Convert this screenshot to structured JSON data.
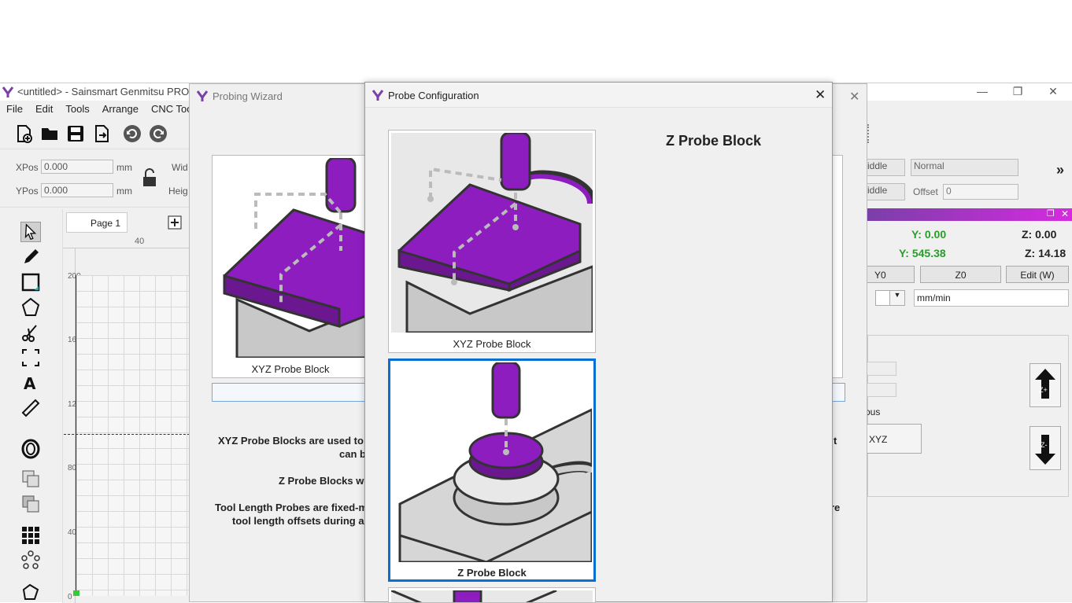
{
  "app": {
    "title": "<untitled> - Sainsmart Genmitsu PROVer",
    "menu": [
      "File",
      "Edit",
      "Tools",
      "Arrange",
      "CNC Tools"
    ],
    "xpos_label": "XPos",
    "ypos_label": "YPos",
    "xpos_value": "0.000",
    "ypos_value": "0.000",
    "unit": "mm",
    "width_label": "Wid",
    "height_label": "Heig",
    "page_tab": "Page 1",
    "ruler_top": [
      "40"
    ],
    "ruler_left": [
      "200",
      "160",
      "120",
      "80",
      "40",
      "0"
    ]
  },
  "right_panel": {
    "mode_select_1": "iddle",
    "mode_select_2": "iddle",
    "normal_select": "Normal",
    "offset_label": "Offset",
    "offset_value": "0",
    "y_pos": "Y: 0.00",
    "z_pos": "Z: 0.00",
    "y_machine": "Y: 545.38",
    "z_machine": "Z: 14.18",
    "btn_y0": "Y0",
    "btn_z0": "Z0",
    "btn_edit": "Edit (W)",
    "feed_unit": "mm/min",
    "continuous_label": "ous",
    "btn_xyz": "XYZ",
    "zplus": "Z+",
    "zminus": "Z-"
  },
  "wizard": {
    "title": "Probing Wizard",
    "card_caption": "XYZ Probe Block",
    "desc_line1": "XYZ Probe Blocks are used to s",
    "desc_line1_right": "t",
    "desc_line2": "can b",
    "desc_line3": "Z Probe Blocks wo",
    "desc_line4": "Tool Length Probes are fixed-m",
    "desc_line4_right": "re",
    "desc_line5": "tool length offsets during a"
  },
  "config": {
    "title": "Probe Configuration",
    "heading": "Z Probe Block",
    "options": [
      {
        "label": "XYZ Probe Block",
        "selected": false
      },
      {
        "label": "Z Probe Block",
        "selected": true
      }
    ]
  },
  "colors": {
    "accent": "#0a6fd1",
    "purple": "#8e1dbf",
    "brand": "#7a3fa8"
  }
}
